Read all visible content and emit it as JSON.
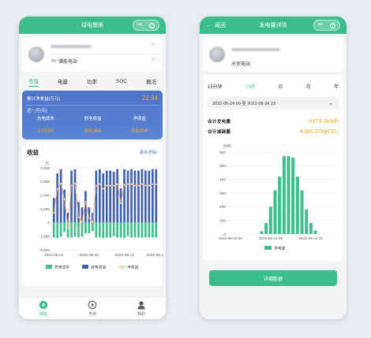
{
  "left_screen": {
    "nav_title": "绿电慧眼",
    "capsule_dots": "•••",
    "stations": [
      {
        "name": "储能电站"
      },
      {
        "name": ""
      }
    ],
    "tabs": [
      "收益",
      "电量",
      "功率",
      "SOC",
      "概况"
    ],
    "active_tab": "收益",
    "summary": {
      "total_label": "累计净收益(万元)",
      "total_value": "22.94",
      "period_label": "近一月(元)",
      "columns": [
        {
          "label": "充电成本",
          "value": "27030"
        },
        {
          "label": "放电收益",
          "value": "80084"
        },
        {
          "label": "净收益",
          "value": "53054"
        }
      ]
    },
    "chart_title": "收益",
    "more_link": "更多详情>",
    "bottom_nav": [
      {
        "label": "储能",
        "icon": "storage-icon",
        "active": true
      },
      {
        "label": "光伏",
        "icon": "solar-icon",
        "active": false
      },
      {
        "label": "我的",
        "icon": "profile-icon",
        "active": false
      }
    ],
    "colors": {
      "accent": "#3bbd8c",
      "charge": "#3fbf8e",
      "discharge": "#3f5fb0",
      "net": "#f0a35e"
    }
  },
  "right_screen": {
    "nav_title": "发电量详情",
    "back_label": "返回",
    "station_name": "光伏电站",
    "time_tabs": [
      "15分钟",
      "小时",
      "日",
      "月",
      "年"
    ],
    "active_time_tab": "小时",
    "date_range": "2022-06-24 00 至 2022-06-24 23",
    "total_generation_label": "合计发电量",
    "total_generation_value": "4379.5kWh",
    "total_reduction_label": "合计减碳量",
    "total_reduction_value": "4366.37kgCO₂",
    "detail_button": "详细数据"
  },
  "chart_data": [
    {
      "type": "bar",
      "title": "",
      "ylabel": "元",
      "ylim": [
        -2000,
        4000
      ],
      "yticks": [
        "4,000",
        "3,000",
        "2,000",
        "1,000",
        "0",
        "-1,000",
        "-2,000"
      ],
      "xticks": [
        "2022-05-22",
        "2022-06-01",
        "2022-06-11",
        "2022-06-21"
      ],
      "legend": [
        "充电成本",
        "放电收益",
        "净收益"
      ],
      "series": [
        {
          "name": "充电成本",
          "values": [
            -1100,
            -1150,
            -1050,
            -700,
            -1100,
            -1100,
            -1050,
            -1100,
            -1050,
            -800,
            -800,
            -650,
            -1100,
            -1100,
            -1150,
            -1100,
            -1100,
            -1000,
            -1100,
            -1100,
            -1150,
            -1000,
            -1100,
            -1100,
            -1100,
            -1100,
            -1100,
            -1100,
            -1100,
            -1100
          ]
        },
        {
          "name": "放电收益",
          "values": [
            1800,
            3600,
            3900,
            2400,
            700,
            3800,
            3900,
            1500,
            1100,
            2300,
            1100,
            700,
            3800,
            3900,
            3600,
            3800,
            3800,
            3700,
            3900,
            2500,
            3900,
            3800,
            3900,
            3800,
            3800,
            3900,
            3800,
            3800,
            3900,
            3900
          ]
        },
        {
          "name": "净收益",
          "values": [
            700,
            2450,
            2850,
            1700,
            -400,
            2700,
            2850,
            400,
            50,
            1500,
            300,
            50,
            2700,
            2800,
            2450,
            2700,
            2700,
            2700,
            2800,
            1400,
            2750,
            2800,
            2800,
            2700,
            2700,
            2800,
            2700,
            2700,
            2800,
            2800
          ]
        }
      ]
    },
    {
      "type": "bar",
      "title": "",
      "ylabel": "kWh",
      "ylim": [
        0,
        600
      ],
      "yticks": [
        "600",
        "500",
        "400",
        "300",
        "200",
        "100",
        "0"
      ],
      "xticks": [
        "2022-06-24 00",
        "2022-06-24 09",
        "2022-06-24 18"
      ],
      "legend": [
        "发电量"
      ],
      "categories": [
        "00",
        "01",
        "02",
        "03",
        "04",
        "05",
        "06",
        "07",
        "08",
        "09",
        "10",
        "11",
        "12",
        "13",
        "14",
        "15",
        "16",
        "17",
        "18",
        "19",
        "20",
        "21",
        "22",
        "23"
      ],
      "series": [
        {
          "name": "发电量",
          "values": [
            0,
            0,
            0,
            0,
            0,
            0,
            0,
            20,
            80,
            200,
            320,
            420,
            570,
            570,
            560,
            420,
            320,
            180,
            80,
            25,
            0,
            0,
            0,
            0
          ]
        }
      ]
    }
  ]
}
